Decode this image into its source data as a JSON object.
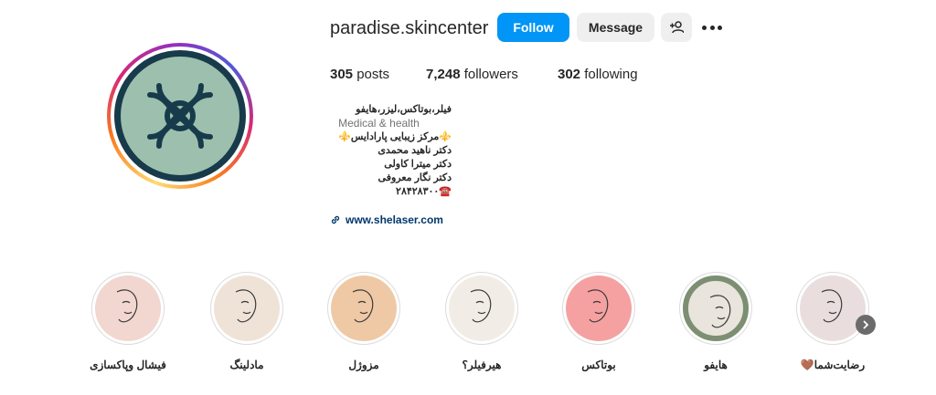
{
  "profile": {
    "username": "paradise.skincenter",
    "follow_label": "Follow",
    "message_label": "Message",
    "stats": {
      "posts": "305",
      "posts_label": "posts",
      "followers": "7,248",
      "followers_label": "followers",
      "following": "302",
      "following_label": "following"
    },
    "bio": {
      "title": "فیلر،بوتاکس،لیزر،هایفو",
      "category": "Medical & health",
      "line1": "⚜️مرکز زیبایی پارادایس⚜️",
      "line2": "دکتر ناهید محمدی",
      "line3": "دکتر میترا کاولی",
      "line4": "دکتر نگار معروفی",
      "line5": "☎️۲۸۴۲۸۳۰۰",
      "link": "www.shelaser.com"
    }
  },
  "highlights": [
    {
      "label": "فیشال وپاکسازی",
      "color": "#f2d6d0"
    },
    {
      "label": "مادلینگ",
      "color": "#efe3d8"
    },
    {
      "label": "مزوژل",
      "color": "#efc9a5"
    },
    {
      "label": "هیرفیلر؟",
      "color": "#f1ede6"
    },
    {
      "label": "بوتاکس",
      "color": "#f5a1a1"
    },
    {
      "label": "هایفو",
      "color": "#e9e4dc"
    },
    {
      "label": "رضایت‌شما🤎",
      "color": "#e9dedd"
    }
  ],
  "icons": {
    "add_user": "add-user-icon",
    "more": "more-options-icon",
    "link": "link-icon",
    "next": "chevron-right-icon"
  },
  "colors": {
    "accent": "#0095f6",
    "avatar_bg": "#9dbfad",
    "avatar_border": "#173b4a"
  }
}
